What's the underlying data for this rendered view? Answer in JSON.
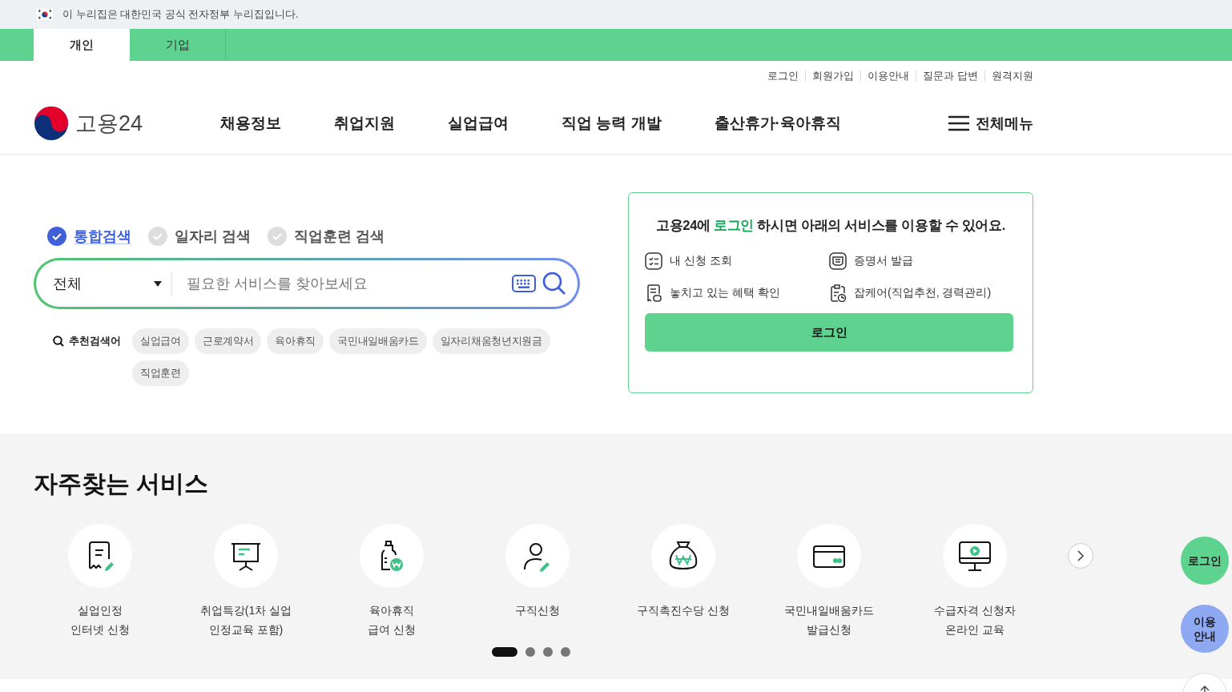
{
  "gov_banner": {
    "text": "이 누리집은 대한민국 공식 전자정부 누리집입니다."
  },
  "user_tabs": [
    {
      "label": "개인",
      "selected": true
    },
    {
      "label": "기업",
      "selected": false
    }
  ],
  "utility_links": [
    "로그인",
    "회원가입",
    "이용안내",
    "질문과 답변",
    "원격지원"
  ],
  "logo": {
    "text": "고용24"
  },
  "main_nav": [
    "채용정보",
    "취업지원",
    "실업급여",
    "직업 능력 개발",
    "출산휴가·육아휴직"
  ],
  "all_menu": {
    "label": "전체메뉴"
  },
  "search": {
    "scopes": [
      {
        "label": "통합검색",
        "selected": true
      },
      {
        "label": "일자리 검색",
        "selected": false
      },
      {
        "label": "직업훈련 검색",
        "selected": false
      }
    ],
    "category": "전체",
    "placeholder": "필요한 서비스를 찾아보세요",
    "recommended_label": "추천검색어",
    "recommended": [
      "실업급여",
      "근로계약서",
      "육아휴직",
      "국민내일배움카드",
      "일자리채움청년지원금",
      "직업훈련"
    ]
  },
  "login_card": {
    "message_start": "고용24에",
    "message_link": "로그인",
    "message_end": "하시면 아래의 서비스를 이용할 수 있어요.",
    "features": [
      "내 신청 조회",
      "증명서 발급",
      "놓치고 있는 혜택 확인",
      "잡케어(직업추천, 경력관리)"
    ],
    "button": "로그인"
  },
  "services": {
    "title": "자주찾는 서비스",
    "items": [
      "실업인정\n인터넷 신청",
      "취업특강(1차 실업\n인정교육 포함)",
      "육아휴직\n급여 신청",
      "구직신청",
      "구직촉진수당 신청",
      "국민내일배움카드\n발급신청",
      "수급자격 신청자\n온라인 교육"
    ],
    "pages": [
      {
        "selected": true
      },
      {
        "selected": false
      },
      {
        "selected": false
      },
      {
        "selected": false
      }
    ]
  },
  "floating_buttons": [
    {
      "label": "로그인",
      "kind": "login"
    },
    {
      "label": "이용\n안내",
      "kind": "guide"
    }
  ]
}
